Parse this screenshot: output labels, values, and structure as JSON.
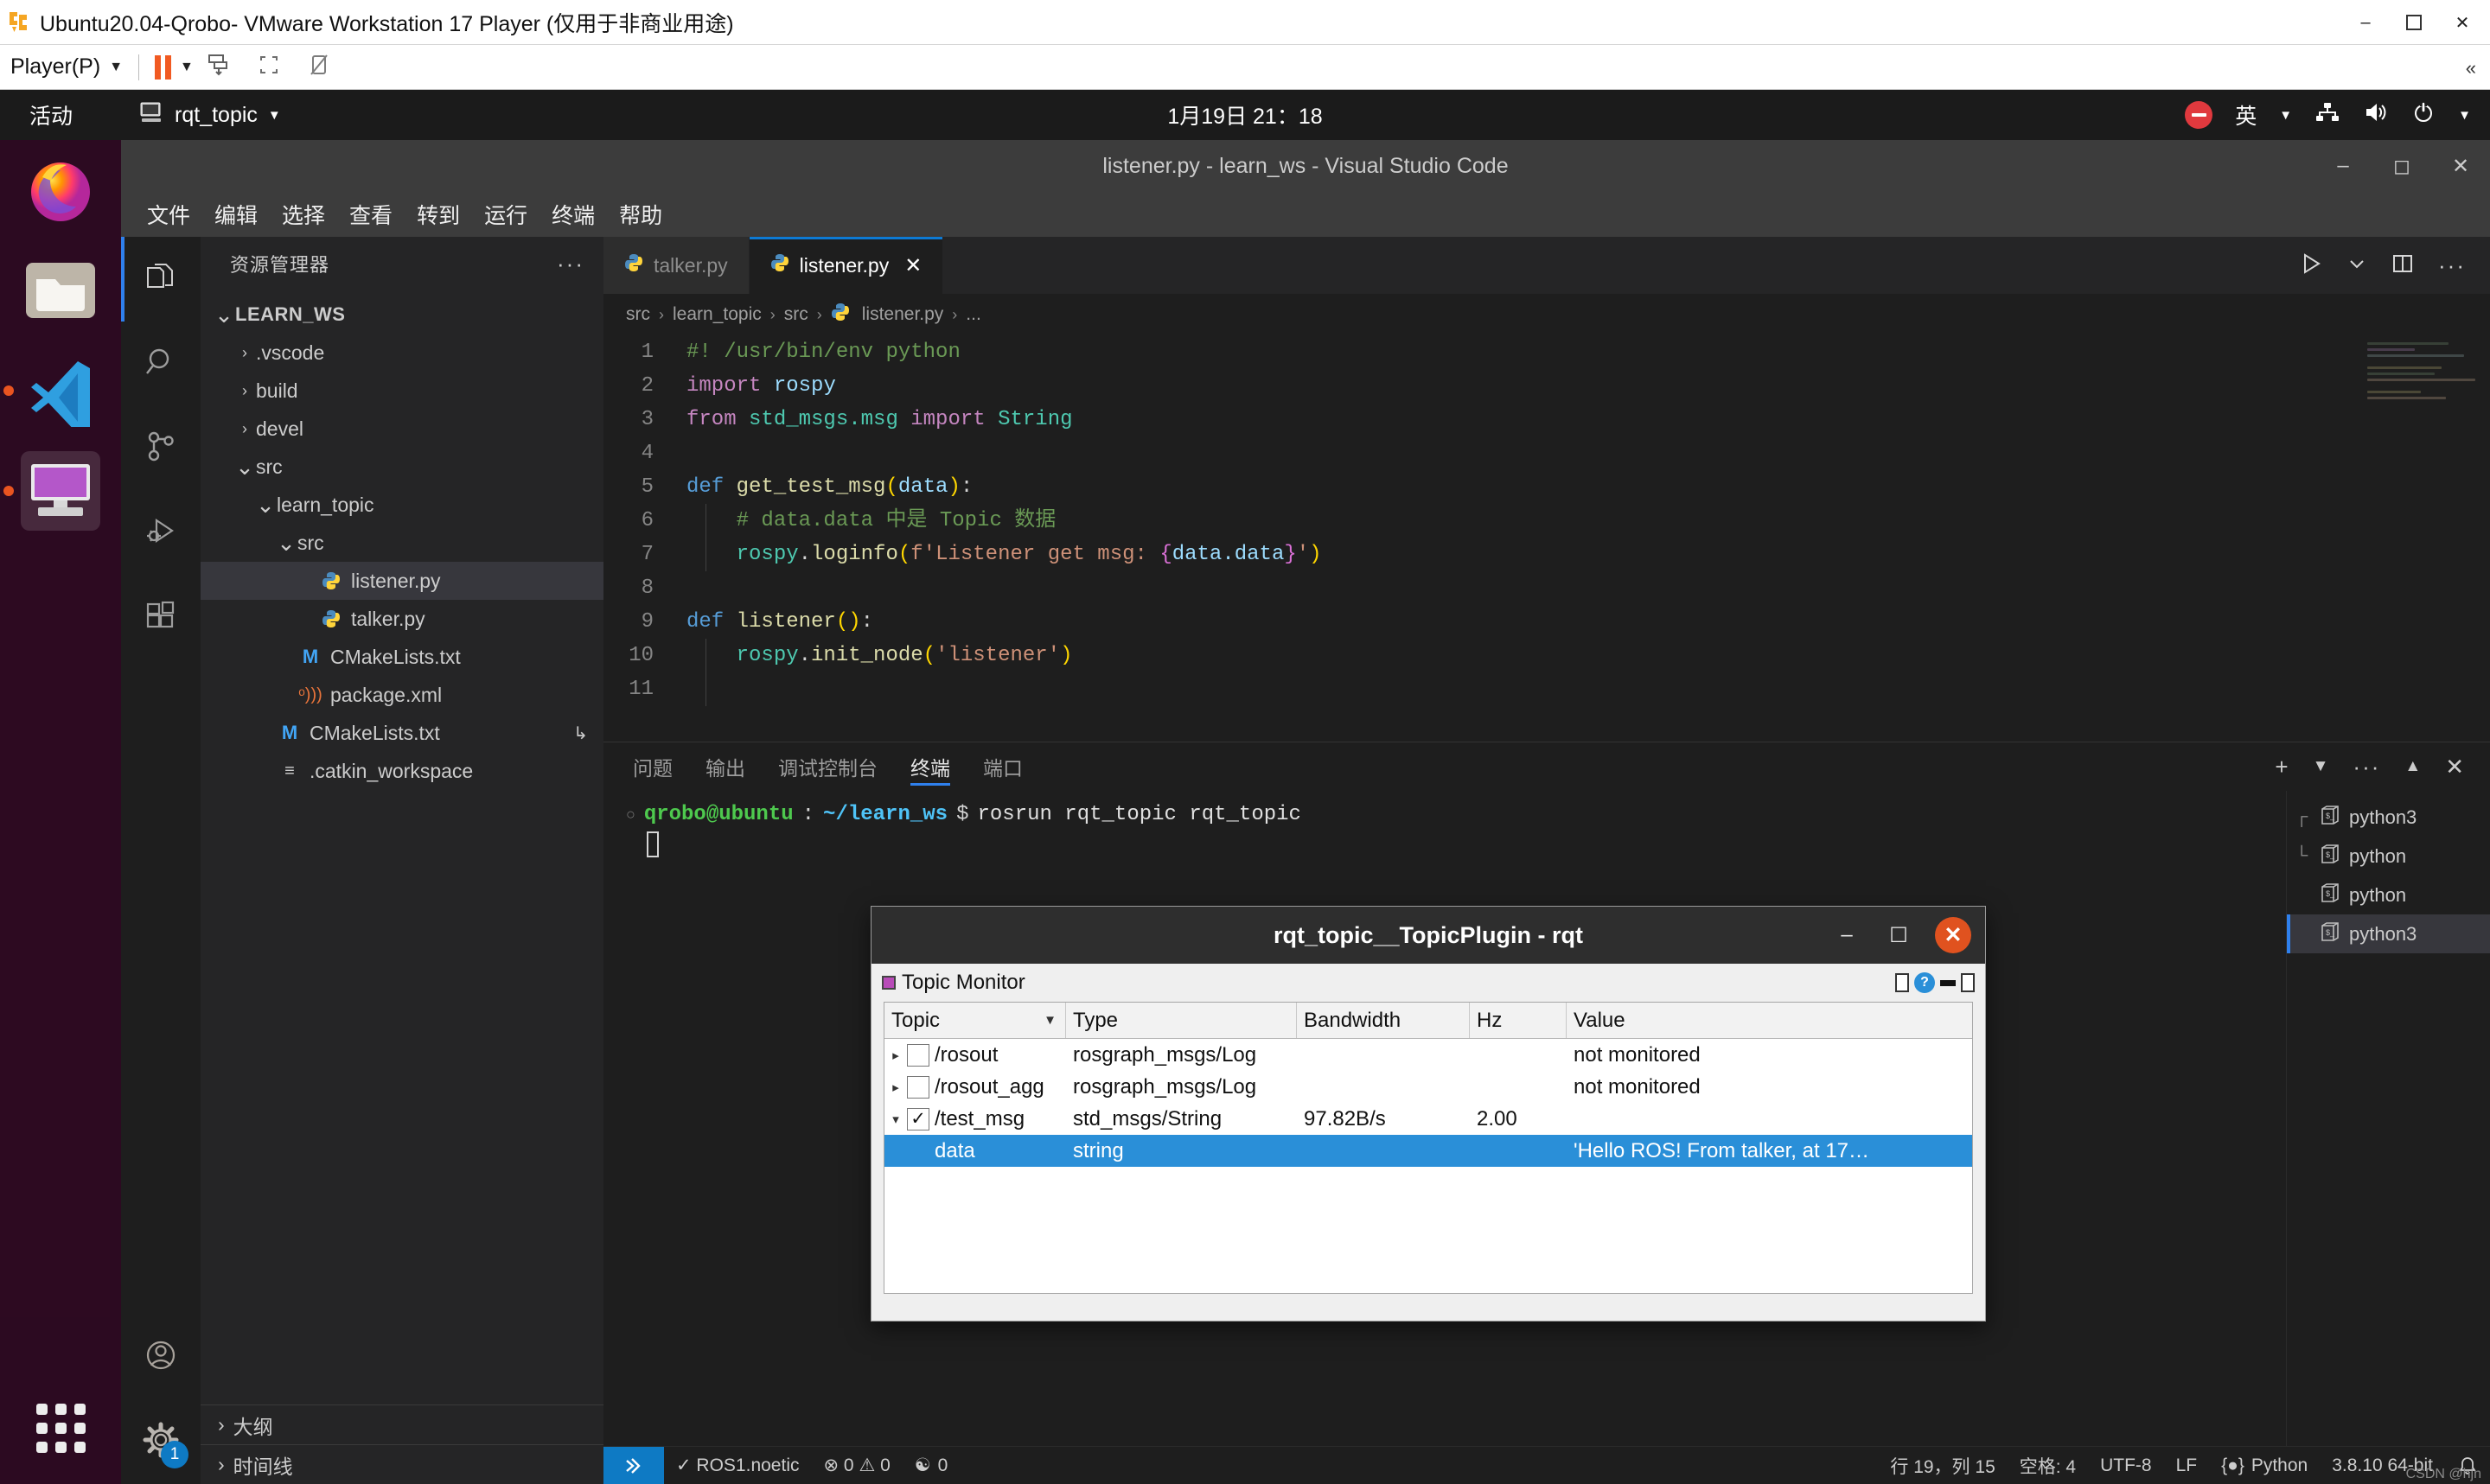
{
  "vmware": {
    "title": "Ubuntu20.04-Qrobo- VMware Workstation 17 Player (仅用于非商业用途)",
    "player_menu": "Player(P)",
    "icons": [
      "vmware-logo-icon",
      "pause-icon",
      "dropdown-caret-icon",
      "send-ctrl-alt-del-icon",
      "unity-mode-icon",
      "full-screen-icon",
      "collapse-toolbar-icon"
    ],
    "window_buttons": [
      "minimize-icon",
      "restore-icon",
      "close-icon"
    ]
  },
  "ubuntu": {
    "topbar": {
      "activities": "活动",
      "app_name": "rqt_topic",
      "clock": "1月19日 21：18",
      "ime": "英",
      "icons": [
        "display-icon",
        "dnd-icon",
        "network-icon",
        "volume-icon",
        "power-icon",
        "menu-caret-icon"
      ]
    },
    "dock": {
      "items": [
        {
          "name": "firefox",
          "running": false
        },
        {
          "name": "files",
          "running": false
        },
        {
          "name": "vscode",
          "running": true
        },
        {
          "name": "vmware-remote-desktop",
          "running": true
        }
      ],
      "apps_button": "show-applications"
    }
  },
  "vscode": {
    "title": "listener.py - learn_ws - Visual Studio Code",
    "menus": [
      "文件",
      "编辑",
      "选择",
      "查看",
      "转到",
      "运行",
      "终端",
      "帮助"
    ],
    "window_buttons": [
      "minimize-icon",
      "maximize-icon",
      "close-icon"
    ],
    "activity_bar": {
      "items": [
        {
          "name": "explorer",
          "icon": "files-icon",
          "active": true
        },
        {
          "name": "search",
          "icon": "search-icon",
          "active": false
        },
        {
          "name": "source-control",
          "icon": "source-control-icon",
          "active": false
        },
        {
          "name": "run-debug",
          "icon": "run-debug-icon",
          "active": false
        },
        {
          "name": "extensions",
          "icon": "extensions-icon",
          "active": false
        }
      ],
      "bottom": [
        {
          "name": "accounts",
          "icon": "account-icon"
        },
        {
          "name": "settings",
          "icon": "gear-icon",
          "badge": "1"
        }
      ]
    },
    "sidebar": {
      "title": "资源管理器",
      "more_actions": "···",
      "tree": [
        {
          "label": "LEARN_WS",
          "depth": 0,
          "twisty": "down",
          "bold": true,
          "icon": "none",
          "selected": false
        },
        {
          "label": ".vscode",
          "depth": 1,
          "twisty": "right",
          "bold": false,
          "icon": "none",
          "selected": false
        },
        {
          "label": "build",
          "depth": 1,
          "twisty": "right",
          "bold": false,
          "icon": "none",
          "selected": false
        },
        {
          "label": "devel",
          "depth": 1,
          "twisty": "right",
          "bold": false,
          "icon": "none",
          "selected": false
        },
        {
          "label": "src",
          "depth": 1,
          "twisty": "down",
          "bold": false,
          "icon": "none",
          "selected": false
        },
        {
          "label": "learn_topic",
          "depth": 2,
          "twisty": "down",
          "bold": false,
          "icon": "none",
          "selected": false
        },
        {
          "label": "src",
          "depth": 3,
          "twisty": "down",
          "bold": false,
          "icon": "none",
          "selected": false
        },
        {
          "label": "listener.py",
          "depth": 4,
          "twisty": "none",
          "bold": false,
          "icon": "python-icon",
          "selected": true
        },
        {
          "label": "talker.py",
          "depth": 4,
          "twisty": "none",
          "bold": false,
          "icon": "python-icon",
          "selected": false
        },
        {
          "label": "CMakeLists.txt",
          "depth": 3,
          "twisty": "none",
          "bold": false,
          "icon": "cmake-icon",
          "selected": false
        },
        {
          "label": "package.xml",
          "depth": 3,
          "twisty": "none",
          "bold": false,
          "icon": "xml-icon",
          "selected": false
        },
        {
          "label": "CMakeLists.txt",
          "depth": 2,
          "twisty": "none",
          "bold": false,
          "icon": "cmake-icon",
          "selected": false,
          "suffix": "↳"
        },
        {
          "label": ".catkin_workspace",
          "depth": 2,
          "twisty": "none",
          "bold": false,
          "icon": "txt-icon",
          "selected": false
        }
      ],
      "sections": [
        {
          "label": "大纲",
          "expanded": false
        },
        {
          "label": "时间线",
          "expanded": false
        }
      ]
    },
    "editor": {
      "tabs": [
        {
          "label": "talker.py",
          "icon": "python-icon",
          "active": false,
          "closable": false
        },
        {
          "label": "listener.py",
          "icon": "python-icon",
          "active": true,
          "closable": true
        }
      ],
      "tab_actions": [
        "run-python-file-icon",
        "run-chevron-icon",
        "split-editor-icon",
        "more-actions-icon"
      ],
      "breadcrumb": [
        "src",
        "learn_topic",
        "src",
        "listener.py",
        "..."
      ],
      "lines": [
        {
          "n": "1",
          "tokens": [
            {
              "t": "#! /usr/bin/env python",
              "c": "t-com"
            }
          ]
        },
        {
          "n": "2",
          "tokens": [
            {
              "t": "import ",
              "c": "t-kw"
            },
            {
              "t": "rospy",
              "c": "t-var"
            }
          ]
        },
        {
          "n": "3",
          "tokens": [
            {
              "t": "from ",
              "c": "t-kw"
            },
            {
              "t": "std_msgs.msg ",
              "c": "t-cls"
            },
            {
              "t": "import ",
              "c": "t-kw"
            },
            {
              "t": "String",
              "c": "t-cls"
            }
          ]
        },
        {
          "n": "4",
          "tokens": []
        },
        {
          "n": "5",
          "tokens": [
            {
              "t": "def ",
              "c": "t-def"
            },
            {
              "t": "get_test_msg",
              "c": "t-fn"
            },
            {
              "t": "(",
              "c": "t-br1"
            },
            {
              "t": "data",
              "c": "t-var"
            },
            {
              "t": ")",
              "c": "t-br1"
            },
            {
              "t": ":",
              "c": "t-plain"
            }
          ]
        },
        {
          "n": "6",
          "tokens": [
            {
              "t": "    # data.data 中是 Topic 数据",
              "c": "t-com"
            }
          ]
        },
        {
          "n": "7",
          "tokens": [
            {
              "t": "    ",
              "c": "t-plain"
            },
            {
              "t": "rospy",
              "c": "t-cls"
            },
            {
              "t": ".",
              "c": "t-plain"
            },
            {
              "t": "loginfo",
              "c": "t-fn"
            },
            {
              "t": "(",
              "c": "t-br1"
            },
            {
              "t": "f'Listener get msg: ",
              "c": "t-str"
            },
            {
              "t": "{",
              "c": "t-br2"
            },
            {
              "t": "data.data",
              "c": "t-var"
            },
            {
              "t": "}",
              "c": "t-br2"
            },
            {
              "t": "'",
              "c": "t-str"
            },
            {
              "t": ")",
              "c": "t-br1"
            }
          ]
        },
        {
          "n": "8",
          "tokens": []
        },
        {
          "n": "9",
          "tokens": [
            {
              "t": "def ",
              "c": "t-def"
            },
            {
              "t": "listener",
              "c": "t-fn"
            },
            {
              "t": "(",
              "c": "t-br1"
            },
            {
              "t": ")",
              "c": "t-br1"
            },
            {
              "t": ":",
              "c": "t-plain"
            }
          ]
        },
        {
          "n": "10",
          "tokens": [
            {
              "t": "    ",
              "c": "t-plain"
            },
            {
              "t": "rospy",
              "c": "t-cls"
            },
            {
              "t": ".",
              "c": "t-plain"
            },
            {
              "t": "init_node",
              "c": "t-fn"
            },
            {
              "t": "(",
              "c": "t-br1"
            },
            {
              "t": "'listener'",
              "c": "t-str"
            },
            {
              "t": ")",
              "c": "t-br1"
            }
          ]
        },
        {
          "n": "11",
          "tokens": []
        }
      ]
    },
    "panel": {
      "tabs": [
        {
          "label": "问题",
          "active": false
        },
        {
          "label": "输出",
          "active": false
        },
        {
          "label": "调试控制台",
          "active": false
        },
        {
          "label": "终端",
          "active": true
        },
        {
          "label": "端口",
          "active": false
        }
      ],
      "actions": [
        "add-terminal-icon",
        "terminal-dropdown-icon",
        "panel-more-icon",
        "maximize-panel-icon",
        "close-panel-icon"
      ],
      "terminal": {
        "user": "qrobo@ubuntu",
        "separator": ":",
        "path": "~/learn_ws",
        "prompt": "$",
        "command": "rosrun rqt_topic rqt_topic"
      },
      "terminal_list": [
        {
          "label": "python3",
          "branch": "┌",
          "active": false
        },
        {
          "label": "python",
          "branch": "└",
          "active": false
        },
        {
          "label": "python",
          "branch": "",
          "active": false
        },
        {
          "label": "python3",
          "branch": "",
          "active": true
        }
      ]
    },
    "statusbar": {
      "remote_icon": "remote-window-icon",
      "left": [
        {
          "name": "ros-distro",
          "text": "✓ ROS1.noetic"
        },
        {
          "name": "problems",
          "text": "⊗ 0  ⚠ 0"
        },
        {
          "name": "ports-forwarded",
          "text": "0"
        }
      ],
      "right": [
        {
          "name": "cursor-position",
          "text": "行 19，列 15"
        },
        {
          "name": "indentation",
          "text": "空格: 4"
        },
        {
          "name": "encoding",
          "text": "UTF-8"
        },
        {
          "name": "eol",
          "text": "LF"
        },
        {
          "name": "language-mode",
          "text": "Python"
        },
        {
          "name": "python-interpreter",
          "text": "3.8.10 64-bit"
        },
        {
          "name": "notifications",
          "text": "🔔"
        }
      ]
    }
  },
  "rqt": {
    "window_title": "rqt_topic__TopicPlugin - rqt",
    "window_buttons": [
      "minimize-icon",
      "maximize-icon",
      "close-icon"
    ],
    "plugin_title": "Topic Monitor",
    "plugin_icons": [
      "undock-icon",
      "help-icon",
      "close-plugin-icon"
    ],
    "table": {
      "columns": [
        "Topic",
        "Type",
        "Bandwidth",
        "Hz",
        "Value"
      ],
      "sorted_column": "Topic",
      "rows": [
        {
          "expander": "▸",
          "checkbox": "",
          "topic": "/rosout",
          "type": "rosgraph_msgs/Log",
          "bandwidth": "",
          "hz": "",
          "value": "not monitored",
          "child": false,
          "selected": false
        },
        {
          "expander": "▸",
          "checkbox": "",
          "topic": "/rosout_agg",
          "type": "rosgraph_msgs/Log",
          "bandwidth": "",
          "hz": "",
          "value": "not monitored",
          "child": false,
          "selected": false
        },
        {
          "expander": "▾",
          "checkbox": "✓",
          "topic": "/test_msg",
          "type": "std_msgs/String",
          "bandwidth": "97.82B/s",
          "hz": "2.00",
          "value": "",
          "child": false,
          "selected": false
        },
        {
          "expander": "",
          "checkbox": null,
          "topic": "data",
          "type": "string",
          "bandwidth": "",
          "hz": "",
          "value": "'Hello ROS! From talker, at 17…",
          "child": true,
          "selected": true
        }
      ]
    }
  },
  "watermark": "CSDN @hjn"
}
